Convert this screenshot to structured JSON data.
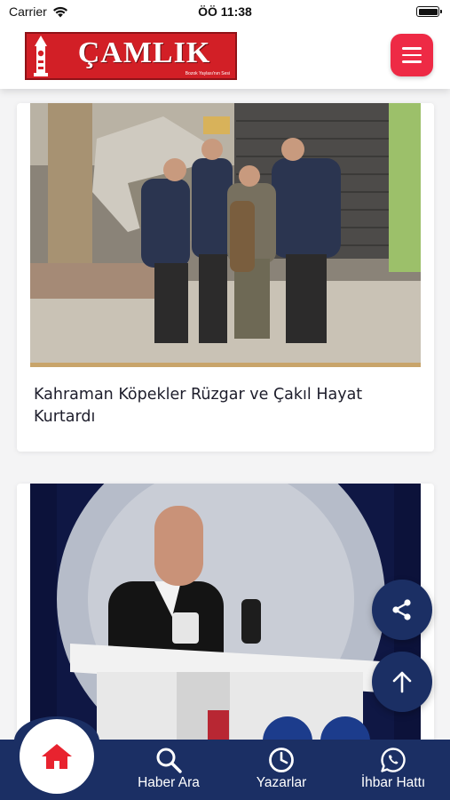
{
  "status_bar": {
    "carrier": "Carrier",
    "time": "ÖÖ 11:38"
  },
  "header": {
    "logo_text": "ÇAMLIK",
    "logo_slogan": "Bozok Yaylası'nın Sesi",
    "menu_icon": "hamburger-icon",
    "colors": {
      "logo": "#d21f26",
      "menu_button": "#ee2a45"
    }
  },
  "feed": {
    "articles": [
      {
        "title": "Kahraman Köpekler Rüzgar ve Çakıl Hayat Kurtardı"
      },
      {
        "title": ""
      }
    ],
    "accent_line_color": "#c8a46a"
  },
  "floating": {
    "share_icon": "share-icon",
    "scroll_top_icon": "arrow-up-icon"
  },
  "bottom_nav": {
    "home_icon": "home-icon",
    "items": [
      {
        "label": "Haber Ara",
        "icon": "search-icon"
      },
      {
        "label": "Yazarlar",
        "icon": "clock-icon"
      },
      {
        "label": "İhbar Hattı",
        "icon": "whatsapp-icon"
      }
    ],
    "colors": {
      "bar": "#1b2f64",
      "home_icon": "#e8232f"
    }
  }
}
